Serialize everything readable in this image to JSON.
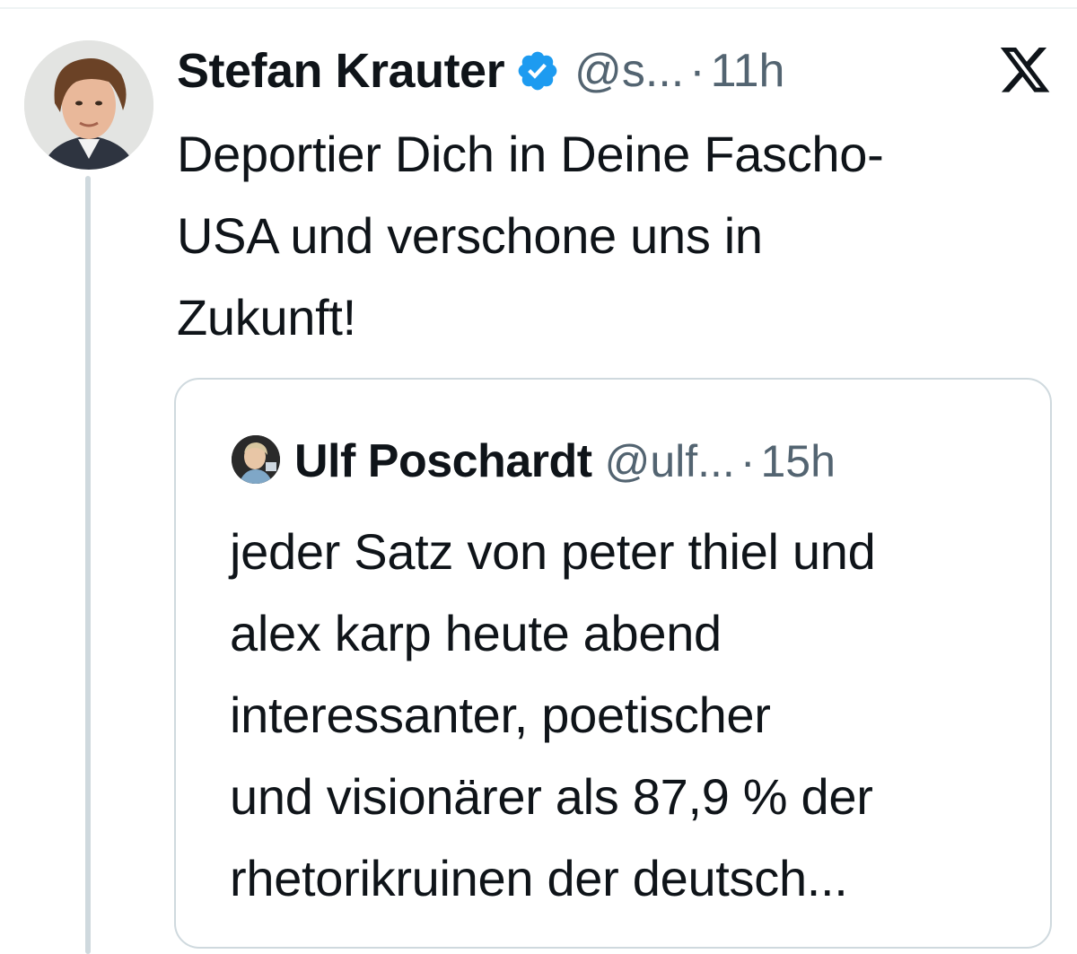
{
  "tweet": {
    "author": {
      "name": "Stefan Krauter",
      "handle": "@s...",
      "verified": true
    },
    "time": "11h",
    "text_lines": [
      "Deportier Dich in Deine Fascho-",
      "USA und verschone uns in",
      "Zukunft!"
    ],
    "brand_icon": "x-logo-icon"
  },
  "quote": {
    "author": {
      "name": "Ulf Poschardt",
      "handle": "@ulf...",
      "verified": false
    },
    "time": "15h",
    "text_lines": [
      "jeder Satz von peter thiel und",
      "alex karp heute abend",
      "interessanter, poetischer",
      "und visionärer als 87,9 % der",
      "rhetorikruinen der deutsch..."
    ]
  },
  "colors": {
    "text": "#0f1419",
    "secondary": "#536471",
    "verified": "#1d9bf0",
    "border": "#cfd9de"
  },
  "separator": "·"
}
